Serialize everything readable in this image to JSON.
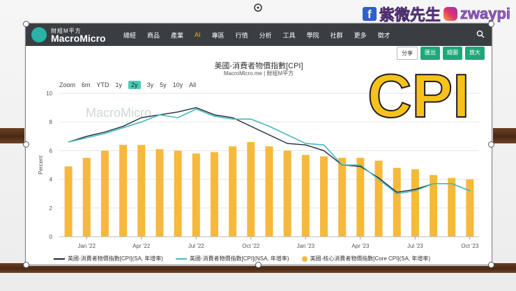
{
  "header": {
    "fb_glyph": "f",
    "author": "紫微先生",
    "handle": "zwaypi"
  },
  "site": {
    "logo_small": "財經M平方",
    "logo_name": "MacroMicro",
    "nav": [
      "總經",
      "商品",
      "產業",
      "AI",
      "專區",
      "行情",
      "分析",
      "工具",
      "學院",
      "社群",
      "更多",
      "徵才"
    ],
    "active_nav_index": 3
  },
  "buttons": {
    "share": "分享",
    "export": "匯出",
    "draw": "繪圖",
    "enlarge": "放大"
  },
  "chart": {
    "title": "美國-消費者物價指數[CPI]",
    "subtitle": "MacroMicro.me | 財經M平方",
    "zoom_label": "Zoom",
    "zoom_options": [
      "6m",
      "YTD",
      "1y",
      "2y",
      "3y",
      "5y",
      "10y",
      "All"
    ],
    "zoom_selected_index": 3,
    "watermark": "MacroMicro",
    "overlay_text": "CPI"
  },
  "chart_data": {
    "type": "bar",
    "ylabel": "Percent",
    "ylim": [
      0,
      10
    ],
    "yticks": [
      0,
      2,
      4,
      6,
      8,
      10
    ],
    "xticks": [
      "Jan '22",
      "Apr '22",
      "Jul '22",
      "Oct '22",
      "Jan '23",
      "Apr '23",
      "Jul '23",
      "Oct '23"
    ],
    "x_tick_index": [
      1,
      4,
      7,
      10,
      13,
      16,
      19,
      22
    ],
    "categories": [
      "2021-12",
      "2022-01",
      "2022-02",
      "2022-03",
      "2022-04",
      "2022-05",
      "2022-06",
      "2022-07",
      "2022-08",
      "2022-09",
      "2022-10",
      "2022-11",
      "2022-12",
      "2023-01",
      "2023-02",
      "2023-03",
      "2023-04",
      "2023-05",
      "2023-06",
      "2023-07",
      "2023-08",
      "2023-09",
      "2023-10"
    ],
    "series": [
      {
        "name": "美國-消費者物價指數[CPI](SA, 年增率)",
        "kind": "line",
        "color": "#1c2a3a",
        "values": [
          6.6,
          7.0,
          7.3,
          7.7,
          8.3,
          8.5,
          8.7,
          9.0,
          8.5,
          8.3,
          7.7,
          7.1,
          6.5,
          6.4,
          6.0,
          5.0,
          4.9,
          4.1,
          3.1,
          3.3,
          3.7,
          3.7,
          3.2
        ]
      },
      {
        "name": "美國-消費者物價指數[CPI](NSA, 年增率)",
        "kind": "line",
        "color": "#48b8bd",
        "values": [
          6.6,
          6.9,
          7.2,
          7.6,
          8.0,
          8.5,
          8.3,
          8.9,
          8.4,
          8.2,
          8.2,
          7.7,
          7.1,
          6.5,
          6.4,
          5.0,
          5.0,
          4.0,
          3.0,
          3.2,
          3.7,
          3.7,
          3.2
        ]
      },
      {
        "name": "美國-核心消費者物價指數[Core CPI](SA, 年增率)",
        "kind": "bar",
        "color": "#f6b93b",
        "values": [
          4.9,
          5.5,
          6.0,
          6.4,
          6.4,
          6.1,
          6.0,
          5.8,
          5.9,
          6.3,
          6.6,
          6.3,
          6.0,
          5.7,
          5.6,
          5.5,
          5.5,
          5.3,
          4.8,
          4.7,
          4.3,
          4.1,
          4.0
        ]
      }
    ]
  }
}
